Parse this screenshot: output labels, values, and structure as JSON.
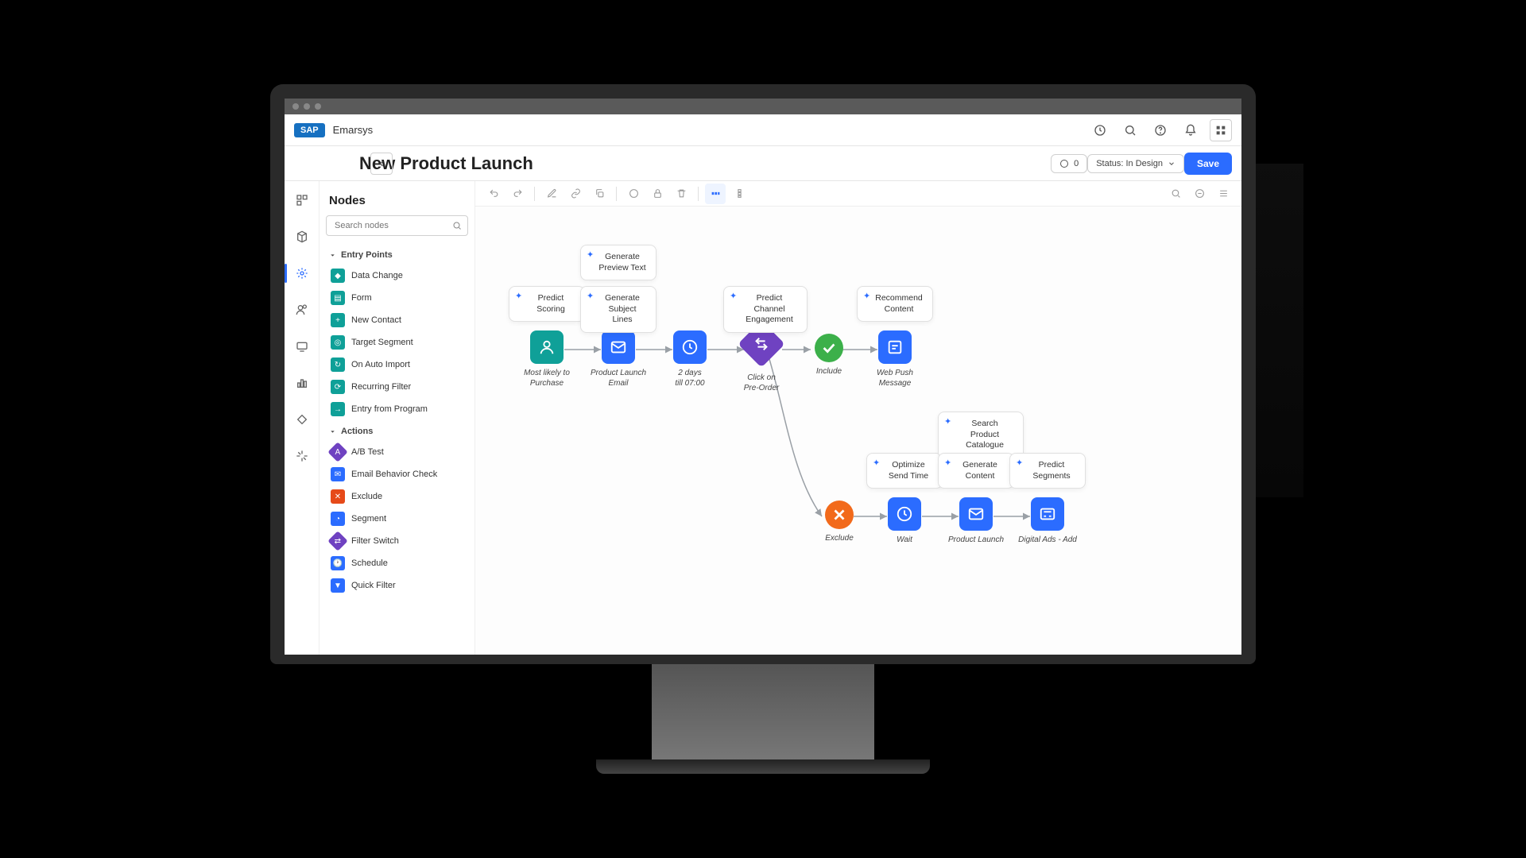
{
  "brand_logo": "SAP",
  "brand_name": "Emarsys",
  "page_title": "New Product Launch",
  "errors_pill": {
    "count": "0"
  },
  "status_pill": {
    "label": "Status: In Design"
  },
  "save_label": "Save",
  "panel_title": "Nodes",
  "search_placeholder": "Search nodes",
  "groups": {
    "entry": {
      "label": "Entry Points",
      "items": [
        {
          "label": "Data Change",
          "color": "teal"
        },
        {
          "label": "Form",
          "color": "teal"
        },
        {
          "label": "New Contact",
          "color": "teal"
        },
        {
          "label": "Target Segment",
          "color": "teal"
        },
        {
          "label": "On Auto Import",
          "color": "teal"
        },
        {
          "label": "Recurring Filter",
          "color": "teal"
        },
        {
          "label": "Entry from Program",
          "color": "teal"
        }
      ]
    },
    "actions": {
      "label": "Actions",
      "items": [
        {
          "label": "A/B Test",
          "color": "purple"
        },
        {
          "label": "Email Behavior Check",
          "color": "blue"
        },
        {
          "label": "Exclude",
          "color": "red"
        },
        {
          "label": "Segment",
          "color": "blue"
        },
        {
          "label": "Filter Switch",
          "color": "purple"
        },
        {
          "label": "Schedule",
          "color": "blue"
        },
        {
          "label": "Quick Filter",
          "color": "blue"
        }
      ]
    }
  },
  "flow_nodes": {
    "n1": "Most likely to\nPurchase",
    "n2": "Product Launch\nEmail",
    "n3": "2 days\ntill 07:00",
    "n4": "Click on\nPre-Order",
    "n5": "Include",
    "n6": "Web Push\nMessage",
    "n7": "Exclude",
    "n8": "Wait",
    "n9": "Product Launch",
    "n10": "Digital Ads - Add"
  },
  "ai_chips": {
    "c1": "Predict\nScoring",
    "c2": "Generate\nPreview Text",
    "c3": "Generate\nSubject Lines",
    "c4": "Predict Channel\nEngagement",
    "c5": "Recommend\nContent",
    "c6": "Optimize\nSend Time",
    "c7": "Search Product\nCatalogue",
    "c8": "Generate\nContent",
    "c9": "Predict\nSegments"
  }
}
